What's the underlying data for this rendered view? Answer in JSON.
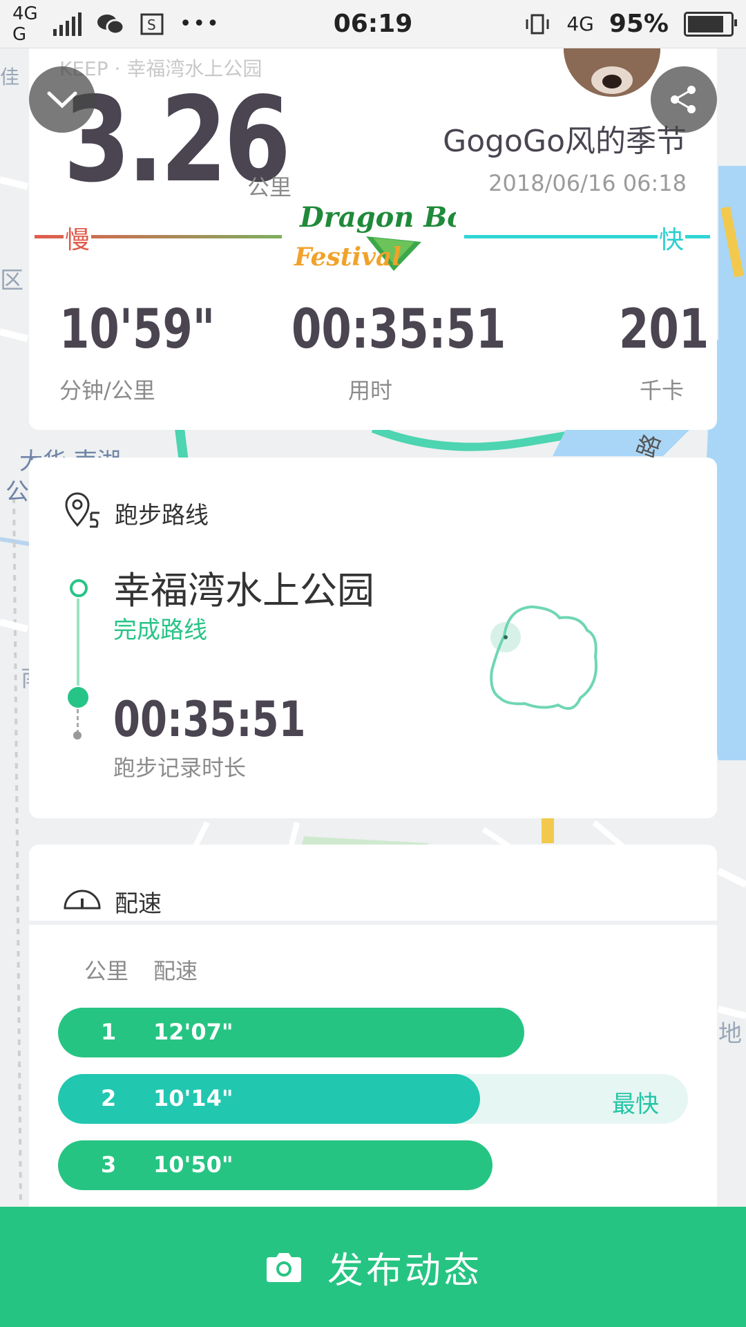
{
  "status_bar": {
    "network_left_top": "4G",
    "network_left_bottom": "G",
    "time": "06:19",
    "network_right": "4G",
    "battery": "95%",
    "battery_level": 0.95
  },
  "map": {
    "labels": [
      "佳",
      "区",
      "大华·南湖",
      "公",
      "南",
      "路",
      "地"
    ]
  },
  "summary": {
    "source_label": "KEEP · 幸福湾水上公园",
    "distance": "3.26",
    "distance_unit": "公里",
    "username": "GogoGo风的季节",
    "datetime": "2018/06/16 06:18",
    "slow_label": "慢",
    "fast_label": "快",
    "festival_line1": "Dragon Boat",
    "festival_line2": "Festival",
    "stats": [
      {
        "value": "10'59\"",
        "label": "分钟/公里"
      },
      {
        "value": "00:35:51",
        "label": "用时"
      },
      {
        "value": "201",
        "label": "千卡"
      }
    ]
  },
  "route": {
    "title": "跑步路线",
    "place": "幸福湾水上公园",
    "status": "完成路线",
    "duration": "00:35:51",
    "duration_label": "跑步记录时长"
  },
  "pace": {
    "title": "配速",
    "col_km": "公里",
    "col_pace": "配速",
    "rows": [
      {
        "km": "1",
        "pace": "12'07\"",
        "fill": 0.74,
        "fastest": false,
        "tag": ""
      },
      {
        "km": "2",
        "pace": "10'14\"",
        "fill": 0.67,
        "fastest": true,
        "tag": "最快"
      },
      {
        "km": "3",
        "pace": "10'50\"",
        "fill": 0.69,
        "fastest": false,
        "tag": ""
      }
    ]
  },
  "publish": {
    "label": "发布动态"
  },
  "colors": {
    "accent": "#26c482",
    "fastest": "#22c7b0",
    "dark_text": "#4a4551"
  }
}
